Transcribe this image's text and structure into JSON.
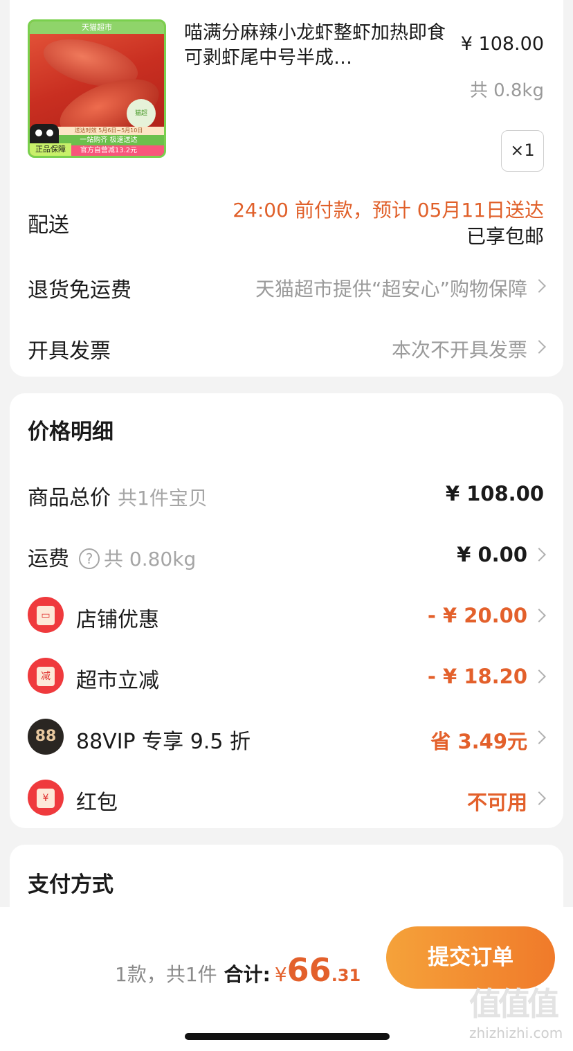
{
  "product": {
    "image": {
      "store_banner": "天猫超市",
      "round_badge": "猫超",
      "strip1": "送达时效 5月6日~5月10日",
      "strip2": "一站购齐 极速送达",
      "strip3": "官方自营减13.2元",
      "guarantee": "正品保障"
    },
    "title": "喵满分麻辣小龙虾整虾加热即食可剥虾尾中号半成…",
    "price": "¥ 108.00",
    "weight": "共 0.8kg",
    "quantity": "×1"
  },
  "delivery": {
    "label": "配送",
    "line1": "24:00 前付款，预计 05月11日送达",
    "line2": "已享包邮"
  },
  "returns": {
    "label": "退货免运费",
    "value": "天猫超市提供“超安心”购物保障"
  },
  "invoice": {
    "label": "开具发票",
    "value": "本次不开具发票"
  },
  "price_detail": {
    "title": "价格明细",
    "goods_total_label": "商品总价",
    "goods_total_sub": "共1件宝贝",
    "goods_total_value": "¥ 108.00",
    "shipping_label": "运费",
    "shipping_help": "?",
    "shipping_sub": "共 0.80kg",
    "shipping_value": "¥ 0.00",
    "discounts": [
      {
        "label": "店铺优惠",
        "value": "- ¥ 20.00",
        "icon": "ticket-icon",
        "icon_text": "▭"
      },
      {
        "label": "超市立减",
        "value": "- ¥ 18.20",
        "icon": "jian-icon",
        "icon_text": "减"
      },
      {
        "label": "88VIP 专享 9.5 折",
        "value": "省 3.49元",
        "icon": "vip88-icon",
        "icon_text": "88"
      },
      {
        "label": "红包",
        "value": "不可用",
        "icon": "red-packet-icon",
        "icon_text": "¥"
      }
    ]
  },
  "payment": {
    "title": "支付方式"
  },
  "bottom_bar": {
    "count_text": "1款，共1件",
    "total_label": "合计:",
    "currency": "¥",
    "total_int": "66",
    "total_dec": ".31",
    "submit_label": "提交订单"
  },
  "watermark": {
    "text": "值值值",
    "url": "zhizhizhi.com"
  },
  "colors": {
    "accent_orange": "#e3602b",
    "button_gradient_start": "#f5a23a",
    "button_gradient_end": "#f07a2a"
  }
}
